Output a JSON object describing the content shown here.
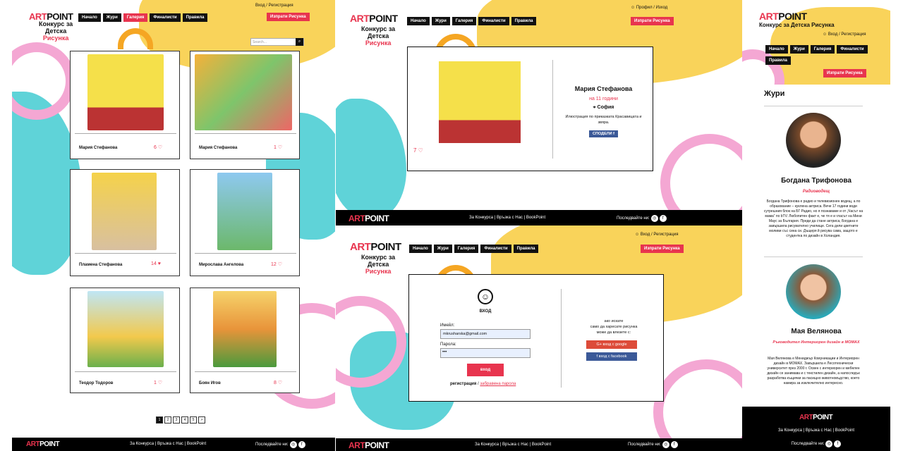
{
  "brand": {
    "logo_art": "ART",
    "logo_point": "POINT",
    "subtitle_l1": "Конкурс за",
    "subtitle_l2": "Детска",
    "subtitle_l3": "Рисунка",
    "subtitle_full": "Конкурс за Детска Рисунка"
  },
  "nav": {
    "home": "Начало",
    "jury": "Жури",
    "gallery": "Галерия",
    "finalists": "Финалисти",
    "rules": "Правила"
  },
  "auth": {
    "login_register": "Вход / Регистрация",
    "profile_logout": "Профил / Изход"
  },
  "submit_button": "Изпрати Рисунка",
  "search": {
    "placeholder": "Search..."
  },
  "gallery": {
    "cards": [
      {
        "name": "Мария Стефанова",
        "likes": "6"
      },
      {
        "name": "Мария Стефанова",
        "likes": "1"
      },
      {
        "name": "Пламена Стефанова",
        "likes": "14"
      },
      {
        "name": "Мирослава Ангелова",
        "likes": "12"
      },
      {
        "name": "Теодор Тодоров",
        "likes": "1"
      },
      {
        "name": "Боян Игов",
        "likes": "8"
      }
    ],
    "pages": [
      "1",
      "2",
      "3",
      "4",
      "5",
      ">"
    ]
  },
  "detail": {
    "name": "Мария Стефанова",
    "age": "на 11 години",
    "city": "София",
    "description": "Илюстрация по приказката Красавицата и звяра.",
    "share": "СПОДЕЛИ",
    "likes": "7"
  },
  "login": {
    "title": "ВХОД",
    "email_label": "Имейл:",
    "email_value": "mkrusharska@gmail.com",
    "password_label": "Парола:",
    "password_value": "•••",
    "submit": "вход",
    "register": "регистрация",
    "separator": "/",
    "forgot": "забравена парола",
    "social_text_l1": "ако искате",
    "social_text_l2": "само да харесате рисунка",
    "social_text_l3": "може да влезете с:",
    "google": "вход с google",
    "facebook": "вход с facebook"
  },
  "jury": {
    "heading": "Жури",
    "members": [
      {
        "name": "Богдана Трифонова",
        "role": "Радиоводещ",
        "bio": "Богдана Трифонова е радио и телевизионен водещ, а по образование – куклена актриса. Вече 17 години води сутрешния блок на БГ Радио, но я познаваме и от „Часът на мама“ по bTV. Любопитен факт е, че тя е и гласът на Мини Маус за България. Преди да стане актриса, Богдана е завършила рисувателно училище. Сега дели цветните моливи със сина си. Дъщеря й рисува сама, защото е студентка по дизайн в Холандия."
      },
      {
        "name": "Мая Велянова",
        "role": "Ръководител Интериорен дизайн в МОМАХ",
        "bio": "Мая Велянова е Мениджър Комуникации и Интериорен дизайн в МОМАХ. Завършила е Лесотехнически университет през 2000 г. Освен с интериорен и мебелен дизайн се занимава и с текстилен дизайн, а напоследък разработва къщички за пасищно животновъдство, което намира за изключително интересно."
      }
    ]
  },
  "footer": {
    "about": "За Конкурса",
    "contact": "Връзка с Нас",
    "bookpoint": "BookPoint",
    "sep": "|",
    "follow": "Последвайте ни:"
  },
  "colors": {
    "accent": "#e8344e",
    "dark": "#111111",
    "yellow": "#f9d35a",
    "cyan": "#5fd3d8",
    "pink": "#f4a7d3"
  }
}
